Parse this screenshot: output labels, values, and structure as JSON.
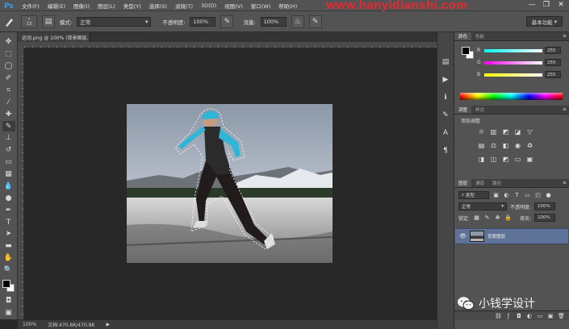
{
  "menubar": {
    "logo": "Ps",
    "items": [
      "文件(F)",
      "编辑(E)",
      "图像(I)",
      "图层(L)",
      "类型(Y)",
      "选择(S)",
      "滤镜(T)",
      "3D(D)",
      "视图(V)",
      "窗口(W)",
      "帮助(H)"
    ],
    "watermark": "www.hanyidianshi.com",
    "win_minimize": "—",
    "win_restore": "❐",
    "win_close": "✕"
  },
  "options": {
    "brush_size": "13",
    "mode_label": "模式:",
    "mode_value": "正常",
    "opacity_label": "不透明度:",
    "opacity_value": "100%",
    "flow_label": "流量:",
    "flow_value": "100%",
    "workspace": "基本功能"
  },
  "document": {
    "tab_title": "运动.png @ 100% (背景图层, RGB/8#) *",
    "tab_close": "×",
    "zoom": "100%",
    "doc_info": "文档:470.8K/470.8K",
    "status_arrow": "▶"
  },
  "color_panel": {
    "tab_active": "颜色",
    "tab_other": "色板",
    "rows": [
      {
        "label": "R",
        "value": "255",
        "track": "linear-gradient(90deg,#00ffff,#ffffff)"
      },
      {
        "label": "G",
        "value": "255",
        "track": "linear-gradient(90deg,#ff00ff,#ffffff)"
      },
      {
        "label": "B",
        "value": "255",
        "track": "linear-gradient(90deg,#ffff00,#ffffff)"
      }
    ]
  },
  "adjustments_panel": {
    "tab_active": "调整",
    "tab_other": "样式",
    "title": "添加调整"
  },
  "layers_panel": {
    "tab_active": "图层",
    "tab_channels": "通道",
    "tab_paths": "路径",
    "filter_kind": "类型",
    "blend_mode": "正常",
    "opacity_label": "不透明度:",
    "opacity_value": "100%",
    "lock_label": "锁定:",
    "fill_label": "填充:",
    "fill_value": "100%",
    "layer_name": "背景图层"
  },
  "wechat_watermark": "小钱学设计",
  "icons": {
    "brush": "brush-icon",
    "eye": "eye-icon",
    "close": "close-icon"
  }
}
